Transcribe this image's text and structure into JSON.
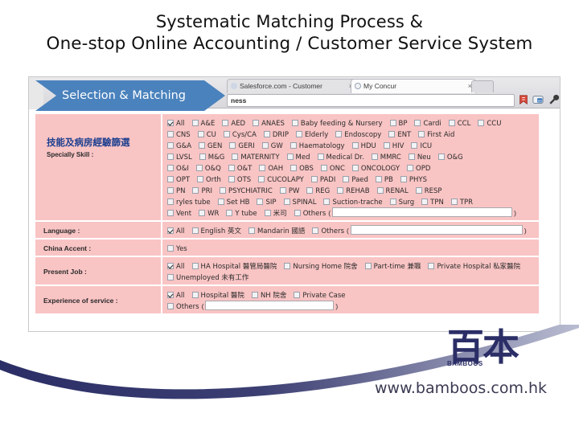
{
  "slide": {
    "title_line1": "Systematic Matching Process &",
    "title_line2": "One-stop Online Accounting / Customer Service System"
  },
  "banner": {
    "label": "Selection & Matching"
  },
  "browser": {
    "tabs": [
      {
        "title": "Salesforce.com - Customer",
        "close": "×",
        "icon": "cloud-favicon"
      },
      {
        "title": "My Concur",
        "close": "×",
        "icon": "concur-favicon"
      }
    ],
    "new_tab_label": "",
    "back_forward": "◂",
    "omnibox_value": "ness",
    "toolbar_icons": [
      "bookmark-icon",
      "translate-icon",
      "wrench-icon"
    ]
  },
  "form": {
    "skill": {
      "label_cn": "技能及病房經驗篩選",
      "label_en": "Specially Skill :",
      "rows": [
        [
          {
            "label": "All",
            "checked": true
          },
          {
            "label": "A&E",
            "checked": false
          },
          {
            "label": "AED",
            "checked": false
          },
          {
            "label": "ANAES",
            "checked": false
          },
          {
            "label": "Baby feeding & Nursery",
            "checked": false
          },
          {
            "label": "BP",
            "checked": false
          },
          {
            "label": "Cardi",
            "checked": false
          },
          {
            "label": "CCL",
            "checked": false
          },
          {
            "label": "CCU",
            "checked": false
          }
        ],
        [
          {
            "label": "CNS",
            "checked": false
          },
          {
            "label": "CU",
            "checked": false
          },
          {
            "label": "Cys/CA",
            "checked": false
          },
          {
            "label": "DRIP",
            "checked": false
          },
          {
            "label": "Elderly",
            "checked": false
          },
          {
            "label": "Endoscopy",
            "checked": false
          },
          {
            "label": "ENT",
            "checked": false
          },
          {
            "label": "First Aid",
            "checked": false
          }
        ],
        [
          {
            "label": "G&A",
            "checked": false
          },
          {
            "label": "GEN",
            "checked": false
          },
          {
            "label": "GERI",
            "checked": false
          },
          {
            "label": "GW",
            "checked": false
          },
          {
            "label": "Haematology",
            "checked": false
          },
          {
            "label": "HDU",
            "checked": false
          },
          {
            "label": "HIV",
            "checked": false
          },
          {
            "label": "ICU",
            "checked": false
          }
        ],
        [
          {
            "label": "LVSL",
            "checked": false
          },
          {
            "label": "M&G",
            "checked": false
          },
          {
            "label": "MATERNITY",
            "checked": false
          },
          {
            "label": "Med",
            "checked": false
          },
          {
            "label": "Medical Dr.",
            "checked": false
          },
          {
            "label": "MMRC",
            "checked": false
          },
          {
            "label": "Neu",
            "checked": false
          },
          {
            "label": "O&G",
            "checked": false
          }
        ],
        [
          {
            "label": "O&I",
            "checked": false
          },
          {
            "label": "O&Q",
            "checked": false
          },
          {
            "label": "O&T",
            "checked": false
          },
          {
            "label": "OAH",
            "checked": false
          },
          {
            "label": "OBS",
            "checked": false
          },
          {
            "label": "ONC",
            "checked": false
          },
          {
            "label": "ONCOLOGY",
            "checked": false
          },
          {
            "label": "OPD",
            "checked": false
          }
        ],
        [
          {
            "label": "OPT",
            "checked": false
          },
          {
            "label": "Orth",
            "checked": false
          },
          {
            "label": "OTS",
            "checked": false
          },
          {
            "label": "CUCOLAPY",
            "checked": false
          },
          {
            "label": "PADI",
            "checked": false
          },
          {
            "label": "Paed",
            "checked": false
          },
          {
            "label": "PB",
            "checked": false
          },
          {
            "label": "PHYS",
            "checked": false
          }
        ],
        [
          {
            "label": "PN",
            "checked": false
          },
          {
            "label": "PRI",
            "checked": false
          },
          {
            "label": "PSYCHIATRIC",
            "checked": false
          },
          {
            "label": "PW",
            "checked": false
          },
          {
            "label": "REG",
            "checked": false
          },
          {
            "label": "REHAB",
            "checked": false
          },
          {
            "label": "RENAL",
            "checked": false
          },
          {
            "label": "RESP",
            "checked": false
          }
        ],
        [
          {
            "label": "ryles tube",
            "checked": false
          },
          {
            "label": "Set HB",
            "checked": false
          },
          {
            "label": "SIP",
            "checked": false
          },
          {
            "label": "SPINAL",
            "checked": false
          },
          {
            "label": "Suction-trache",
            "checked": false
          },
          {
            "label": "Surg",
            "checked": false
          },
          {
            "label": "TPN",
            "checked": false
          },
          {
            "label": "TPR",
            "checked": false
          }
        ],
        [
          {
            "label": "Vent",
            "checked": false
          },
          {
            "label": "WR",
            "checked": false
          },
          {
            "label": "Y tube",
            "checked": false
          },
          {
            "label": "米司",
            "checked": false
          },
          {
            "label": "Others",
            "checked": false,
            "field": true,
            "field_value": "",
            "field_width": 222
          }
        ]
      ]
    },
    "language": {
      "label": "Language :",
      "rows": [
        [
          {
            "label": "All",
            "checked": true
          },
          {
            "label": "English 英文",
            "checked": false
          },
          {
            "label": "Mandarin 國語",
            "checked": false
          },
          {
            "label": "Others",
            "checked": false,
            "field": true,
            "field_value": "",
            "field_width": 212
          }
        ]
      ]
    },
    "china_accent": {
      "label": "China Accent :",
      "rows": [
        [
          {
            "label": "Yes",
            "checked": false
          }
        ]
      ]
    },
    "present_job": {
      "label": "Present Job :",
      "rows": [
        [
          {
            "label": "All",
            "checked": true
          },
          {
            "label": "HA Hospital 醫管局醫院",
            "checked": false
          },
          {
            "label": "Nursing Home 院舍",
            "checked": false
          },
          {
            "label": "Part-time 兼職",
            "checked": false
          },
          {
            "label": "Private Hospital 私家醫院",
            "checked": false
          }
        ],
        [
          {
            "label": "Unemployed 未有工作",
            "checked": false
          }
        ]
      ]
    },
    "experience": {
      "label": "Experience of service :",
      "rows": [
        [
          {
            "label": "All",
            "checked": true
          },
          {
            "label": "Hospital 醫院",
            "checked": false
          },
          {
            "label": "NH 院舍",
            "checked": false
          },
          {
            "label": "Private Case",
            "checked": false
          }
        ],
        [
          {
            "label": "Others",
            "checked": false,
            "field": true,
            "field_value": "",
            "field_width": 158
          }
        ]
      ]
    }
  },
  "footer": {
    "logo_cn": "百本",
    "logo_mark": "BAMBOOS",
    "url": "www.bamboos.com.hk"
  },
  "colors": {
    "form_pink": "#f9c4c4",
    "banner_blue": "#4a82bd",
    "logo_navy": "#2b2e66",
    "label_blue": "#1d3f8f"
  }
}
